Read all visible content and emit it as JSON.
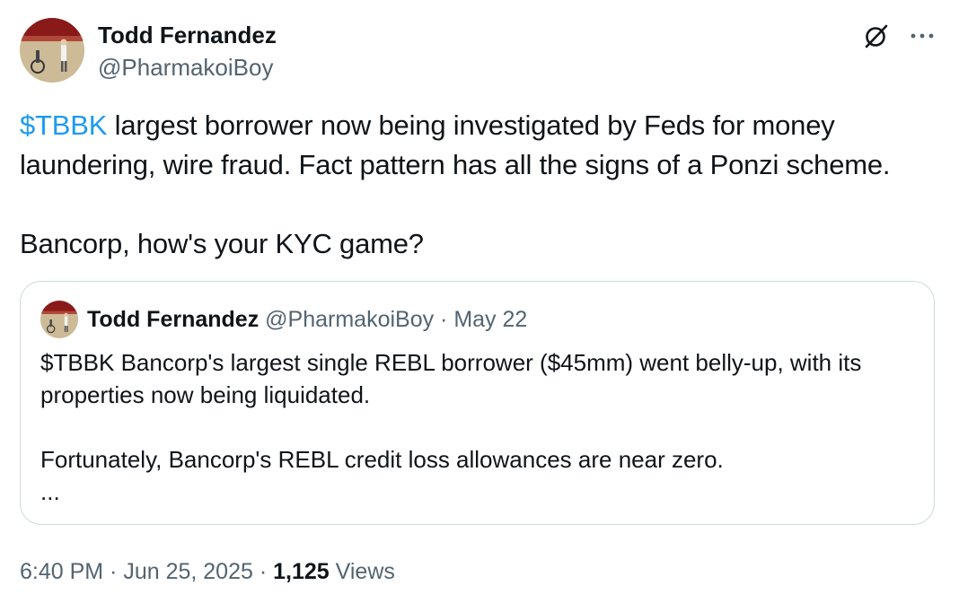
{
  "author": {
    "name": "Todd Fernandez",
    "handle": "@PharmakoiBoy"
  },
  "icons": {
    "grok": "grok-icon",
    "more": "more-options-icon"
  },
  "tweet": {
    "cashtag": "$TBBK",
    "line1_rest": " largest borrower now being investigated by Feds for money laundering, wire fraud. Fact pattern has all the signs of a Ponzi scheme.",
    "line2": "Bancorp, how's your KYC game?"
  },
  "quote": {
    "name": "Todd Fernandez",
    "handle": "@PharmakoiBoy",
    "separator": " · ",
    "date": "May 22",
    "para1": "$TBBK Bancorp's largest single REBL borrower ($45mm) went belly-up, with its properties now being liquidated.",
    "para2": "Fortunately, Bancorp's REBL credit loss allowances are near zero.",
    "ellipsis": "..."
  },
  "meta": {
    "time": "6:40 PM",
    "separator": " · ",
    "date": "Jun 25, 2025",
    "views_count": "1,125",
    "views_label": "Views"
  },
  "colors": {
    "link": "#1d9bf0",
    "text": "#0f1419",
    "secondary": "#536471",
    "border": "#cfd9de"
  }
}
